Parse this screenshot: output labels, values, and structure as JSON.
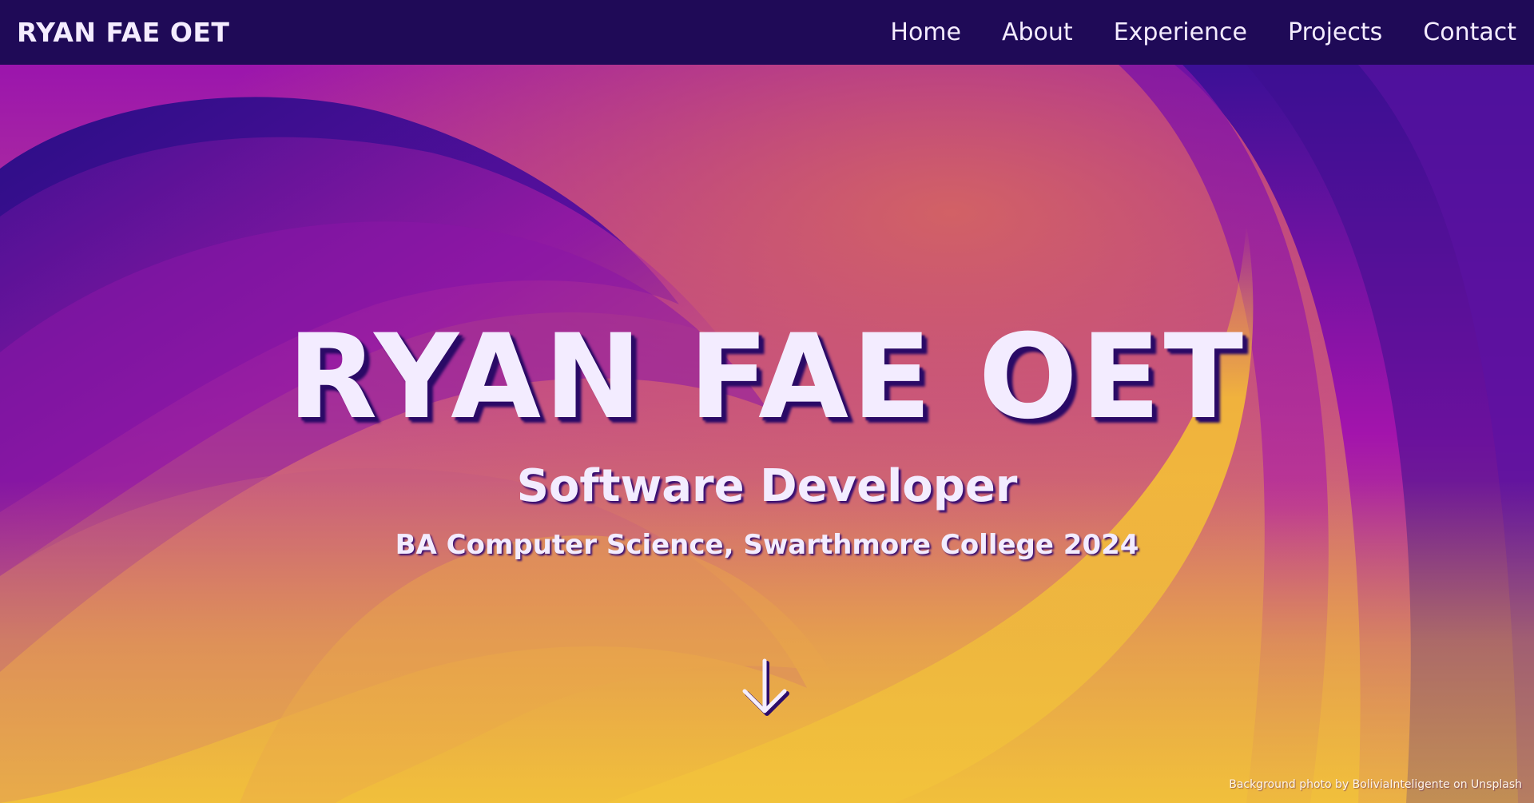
{
  "nav": {
    "brand": "RYAN FAE OET",
    "links": [
      {
        "label": "Home"
      },
      {
        "label": "About"
      },
      {
        "label": "Experience"
      },
      {
        "label": "Projects"
      },
      {
        "label": "Contact"
      }
    ]
  },
  "hero": {
    "title": "RYAN FAE OET",
    "role": "Software Developer",
    "degree": "BA Computer Science, Swarthmore College 2024",
    "scroll_icon": "arrow-down-icon",
    "photo_credit": "Background photo by BoliviaInteligente on Unsplash"
  },
  "colors": {
    "nav_bg": "#1f0a57",
    "text": "#f3ecff",
    "accent_purple": "#a615a9",
    "accent_indigo": "#2d117f",
    "accent_yellow": "#f2be38"
  }
}
